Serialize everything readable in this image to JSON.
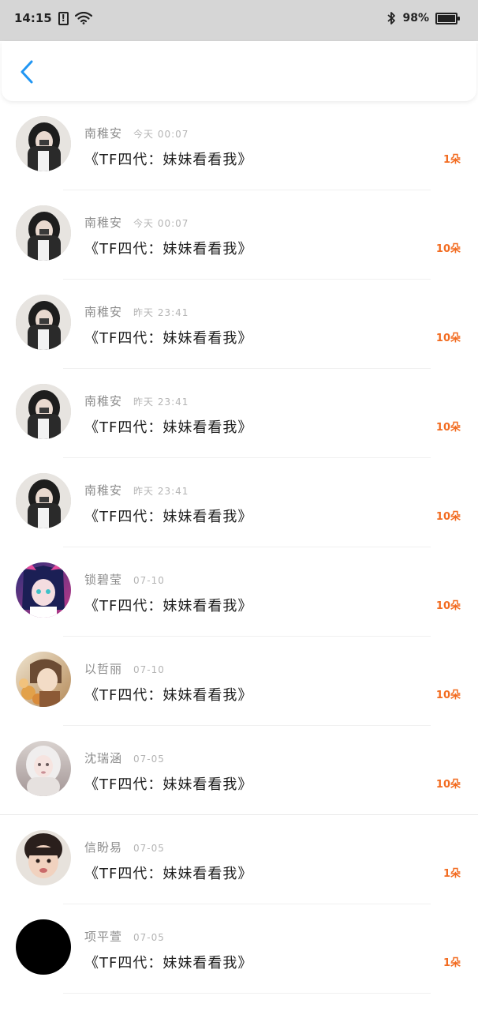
{
  "status_bar": {
    "time": "14:15",
    "alert_glyph": "!",
    "battery_percent": "98%",
    "battery_level": 0.98
  },
  "header": {
    "back_icon": "chevron-left-icon",
    "accent_color": "#2196f3"
  },
  "colors": {
    "amount": "#f26c21",
    "name": "#8c8c8c",
    "title": "#1c1c1c"
  },
  "items": [
    {
      "name": "南稚安",
      "time": "今天 00:07",
      "title": "《TF四代：妹妹看看我》",
      "amount": "1朵",
      "avatar": "girl-portrait"
    },
    {
      "name": "南稚安",
      "time": "今天 00:07",
      "title": "《TF四代：妹妹看看我》",
      "amount": "10朵",
      "avatar": "girl-portrait"
    },
    {
      "name": "南稚安",
      "time": "昨天 23:41",
      "title": "《TF四代：妹妹看看我》",
      "amount": "10朵",
      "avatar": "girl-portrait"
    },
    {
      "name": "南稚安",
      "time": "昨天 23:41",
      "title": "《TF四代：妹妹看看我》",
      "amount": "10朵",
      "avatar": "girl-portrait"
    },
    {
      "name": "南稚安",
      "time": "昨天 23:41",
      "title": "《TF四代：妹妹看看我》",
      "amount": "10朵",
      "avatar": "girl-portrait"
    },
    {
      "name": "锁碧莹",
      "time": "07-10",
      "title": "《TF四代：妹妹看看我》",
      "amount": "10朵",
      "avatar": "anime-girl"
    },
    {
      "name": "以哲丽",
      "time": "07-10",
      "title": "《TF四代：妹妹看看我》",
      "amount": "10朵",
      "avatar": "anime-boy"
    },
    {
      "name": "沈瑞涵",
      "time": "07-05",
      "title": "《TF四代：妹妹看看我》",
      "amount": "10朵",
      "avatar": "white-hair-girl"
    },
    {
      "name": "信盼易",
      "time": "07-05",
      "title": "《TF四代：妹妹看看我》",
      "amount": "1朵",
      "avatar": "child-face"
    },
    {
      "name": "项平萱",
      "time": "07-05",
      "title": "《TF四代：妹妹看看我》",
      "amount": "1朵",
      "avatar": "black-circle"
    }
  ]
}
